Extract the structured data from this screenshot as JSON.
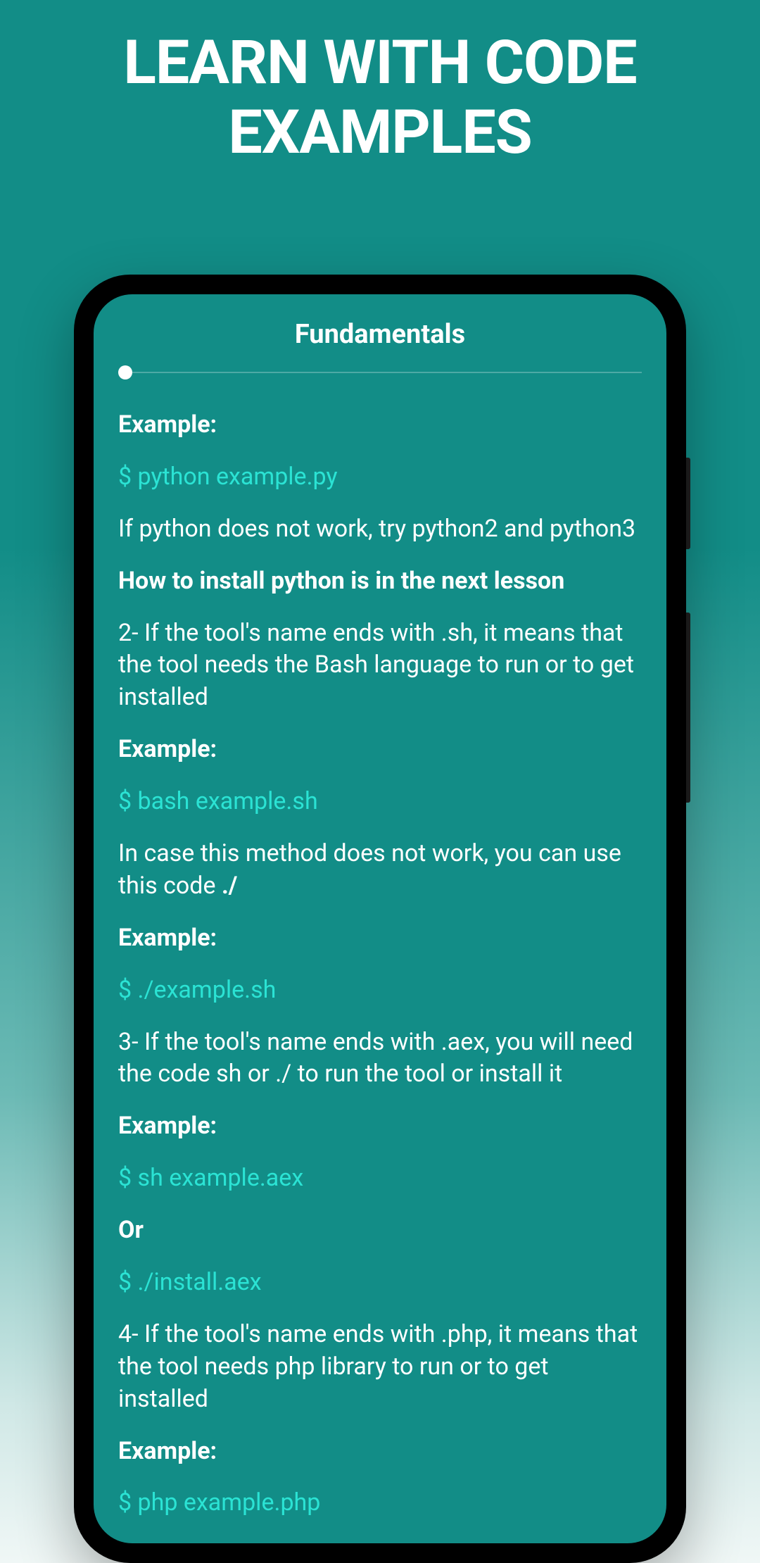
{
  "promo": {
    "title": "LEARN WITH CODE EXAMPLES"
  },
  "app": {
    "title": "Fundamentals"
  },
  "content": {
    "items": [
      {
        "type": "bold",
        "text": "Example:"
      },
      {
        "type": "code",
        "text": "$ python example.py"
      },
      {
        "type": "normal",
        "text": "If python does not work, try python2 and python3"
      },
      {
        "type": "bold",
        "text": "How to install python is in the next lesson"
      },
      {
        "type": "normal",
        "text": "2- If the tool's name ends with .sh, it means that the tool needs the Bash language to run or to get installed"
      },
      {
        "type": "bold",
        "text": "Example:"
      },
      {
        "type": "code",
        "text": "$ bash example.sh"
      },
      {
        "type": "normal-with-bold",
        "text": "In case this method does not work, you can use this code ",
        "boldSuffix": "./"
      },
      {
        "type": "bold",
        "text": "Example:"
      },
      {
        "type": "code",
        "text": "$ ./example.sh"
      },
      {
        "type": "normal",
        "text": "3- If the tool's name ends with .aex, you will need the code sh or ./ to run the tool or install it"
      },
      {
        "type": "bold",
        "text": "Example:"
      },
      {
        "type": "code",
        "text": "$ sh example.aex"
      },
      {
        "type": "bold",
        "text": "Or"
      },
      {
        "type": "code",
        "text": "$ ./install.aex"
      },
      {
        "type": "normal",
        "text": "4- If the tool's name ends with .php, it means that the tool needs php library to run or to get installed"
      },
      {
        "type": "bold",
        "text": "Example:"
      },
      {
        "type": "code",
        "text": "$ php example.php"
      }
    ]
  }
}
